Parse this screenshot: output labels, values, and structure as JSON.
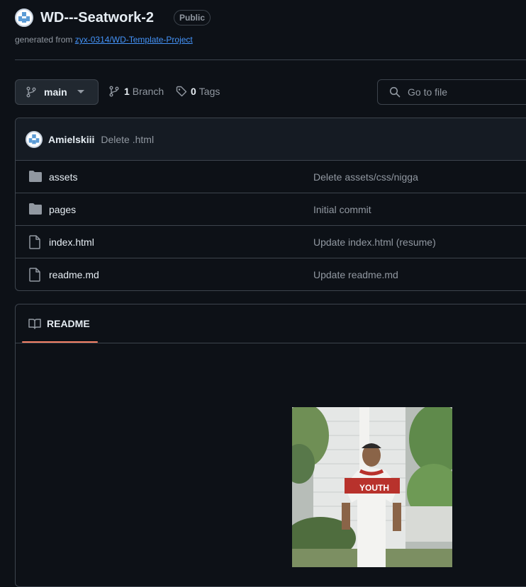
{
  "repo": {
    "name": "WD---Seatwork-2",
    "visibility": "Public",
    "generated_prefix": "generated from ",
    "template_link": "zyx-0314/WD-Template-Project"
  },
  "toolbar": {
    "branch_name": "main",
    "branch_count": "1",
    "branch_label": "Branch",
    "tag_count": "0",
    "tag_label": "Tags",
    "search_placeholder": "Go to file"
  },
  "latest_commit": {
    "author": "Amielskiii",
    "message": "Delete .html"
  },
  "files": [
    {
      "name": "assets",
      "type": "folder",
      "message": "Delete assets/css/nigga"
    },
    {
      "name": "pages",
      "type": "folder",
      "message": "Initial commit"
    },
    {
      "name": "index.html",
      "type": "file",
      "message": "Update index.html (resume)"
    },
    {
      "name": "readme.md",
      "type": "file",
      "message": "Update readme.md"
    }
  ],
  "readme": {
    "tab_label": "README",
    "photo_shirt_text": "YOUTH"
  },
  "colors": {
    "background": "#0d1117",
    "accent_link": "#4493f8",
    "tab_underline": "#f78166",
    "border": "#3d444d"
  }
}
